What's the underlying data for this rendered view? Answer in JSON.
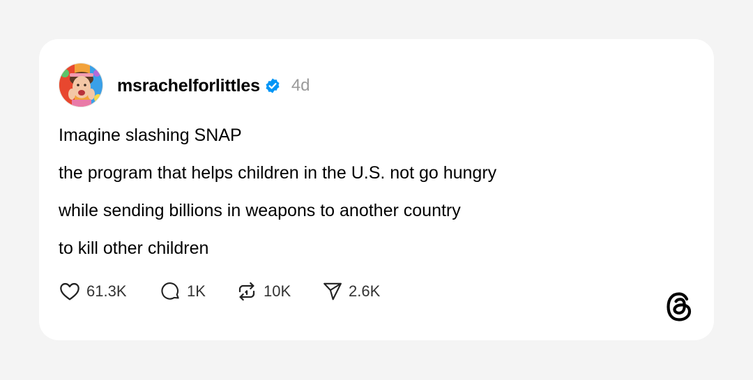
{
  "post": {
    "username": "msrachelforlittles",
    "verified_icon": "verified-badge-icon",
    "time": "4d",
    "lines": [
      "Imagine slashing SNAP",
      "the program that helps children in the U.S. not go hungry",
      "while sending billions in weapons to another country",
      "to kill other children"
    ]
  },
  "actions": {
    "likes": "61.3K",
    "comments": "1K",
    "reposts": "10K",
    "shares": "2.6K"
  },
  "icons": {
    "like": "heart-icon",
    "comment": "comment-bubble-icon",
    "repost": "repost-icon",
    "share": "send-icon",
    "brand": "threads-logo-icon"
  },
  "colors": {
    "background": "#f4f4f4",
    "card": "#ffffff",
    "verified": "#0095f6",
    "muted": "#9a9a9a"
  }
}
